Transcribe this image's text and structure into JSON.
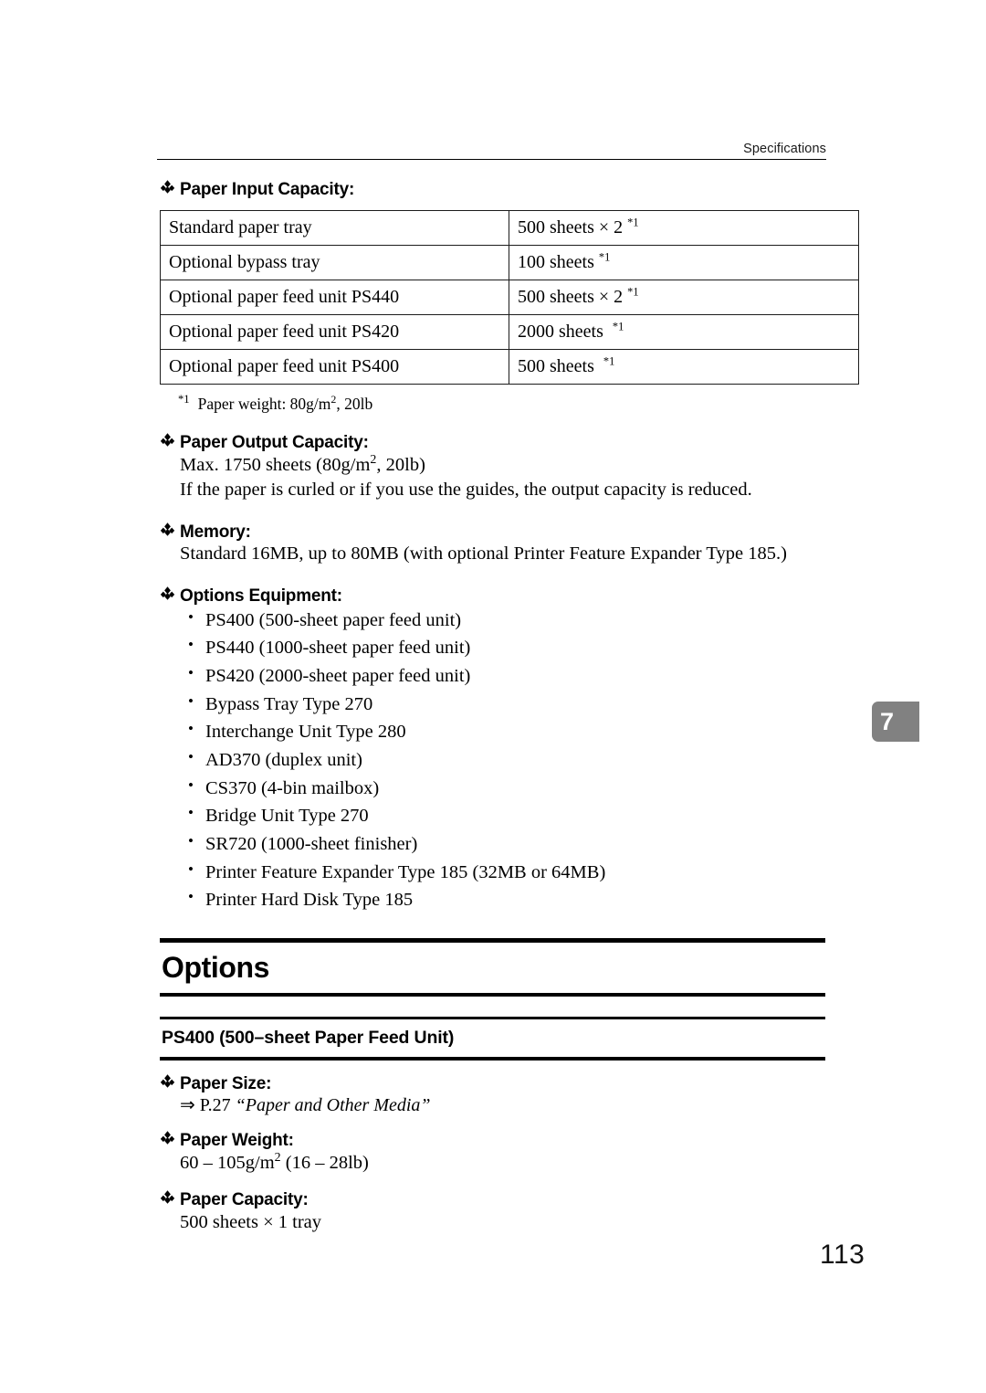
{
  "header": {
    "running_head": "Specifications"
  },
  "colors": {
    "text": "#000000",
    "rule": "#000000",
    "chapter_tab_bg": "#818181",
    "chapter_tab_text": "#ffffff"
  },
  "sections": {
    "paper_input_capacity": {
      "heading": "Paper Input Capacity:",
      "bullet_glyph": "diamond-bullet",
      "table": {
        "rows": [
          {
            "item": "Standard paper tray",
            "value": "500 sheets × 2",
            "footnote": "*1"
          },
          {
            "item": "Optional bypass tray",
            "value": "100 sheets",
            "footnote": "*1"
          },
          {
            "item": "Optional paper feed unit PS440",
            "value": "500 sheets × 2",
            "footnote": "*1"
          },
          {
            "item": "Optional paper feed unit PS420",
            "value": "2000 sheets",
            "footnote": "*1"
          },
          {
            "item": "Optional paper feed unit PS400",
            "value": "500 sheets",
            "footnote": "*1"
          }
        ]
      },
      "footnote": {
        "marker": "*1",
        "text_before_sup": "Paper weight: 80g/m",
        "sup": "2",
        "text_after_sup": ", 20lb"
      }
    },
    "paper_output_capacity": {
      "heading": "Paper Output Capacity:",
      "line1_before_sup": "Max. 1750 sheets (80g/m",
      "line1_sup": "2",
      "line1_after_sup": ", 20lb)",
      "line2": "If the paper is curled or if you use the guides, the output capacity is reduced."
    },
    "memory": {
      "heading": "Memory:",
      "text": "Standard 16MB, up to 80MB (with optional Printer Feature Expander Type 185.)"
    },
    "options_equipment": {
      "heading": "Options Equipment:",
      "items": [
        "PS400 (500-sheet paper feed unit)",
        "PS440 (1000-sheet paper feed unit)",
        "PS420 (2000-sheet paper feed unit)",
        "Bypass Tray Type 270",
        "Interchange Unit Type 280",
        "AD370 (duplex unit)",
        "CS370 (4-bin mailbox)",
        "Bridge Unit Type 270",
        "SR720 (1000-sheet finisher)",
        "Printer Feature Expander Type 185 (32MB or 64MB)",
        "Printer Hard Disk Type 185"
      ]
    },
    "options": {
      "title": "Options",
      "subsection_title": "PS400 (500–sheet Paper Feed Unit)",
      "paper_size": {
        "heading": "Paper Size:",
        "reference_arrow": "⇒",
        "reference_page": "P.27",
        "reference_title": "“Paper and Other Media”"
      },
      "paper_weight": {
        "heading": "Paper Weight:",
        "value_before_sup": "60 – 105g/m",
        "value_sup": "2",
        "value_after_sup": " (16 – 28lb)"
      },
      "paper_capacity": {
        "heading": "Paper Capacity:",
        "value": "500 sheets × 1 tray"
      }
    }
  },
  "chapter_tab": {
    "number": "7"
  },
  "folio": {
    "page_number": "113"
  }
}
